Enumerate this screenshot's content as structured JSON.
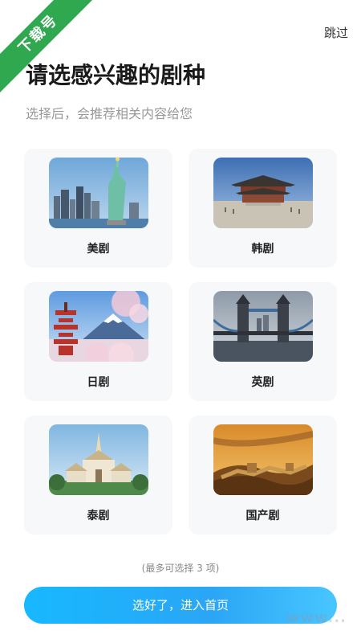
{
  "ribbon": {
    "text": "下载号",
    "color": "#2fa84f"
  },
  "header": {
    "skip_label": "跳过"
  },
  "title": "请选感兴趣的剧种",
  "subtitle": "选择后，会推荐相关内容给您",
  "genres": [
    {
      "label": "美剧",
      "icon": "statue-of-liberty-icon"
    },
    {
      "label": "韩剧",
      "icon": "korean-palace-icon"
    },
    {
      "label": "日剧",
      "icon": "mount-fuji-pagoda-icon"
    },
    {
      "label": "英剧",
      "icon": "tower-bridge-icon"
    },
    {
      "label": "泰剧",
      "icon": "thai-temple-icon"
    },
    {
      "label": "国产剧",
      "icon": "great-wall-icon"
    }
  ],
  "hint": "(最多可选择 3 项)",
  "cta": {
    "label": "选好了，进入首页",
    "color": "#17b8ff"
  },
  "watermark": "www..."
}
